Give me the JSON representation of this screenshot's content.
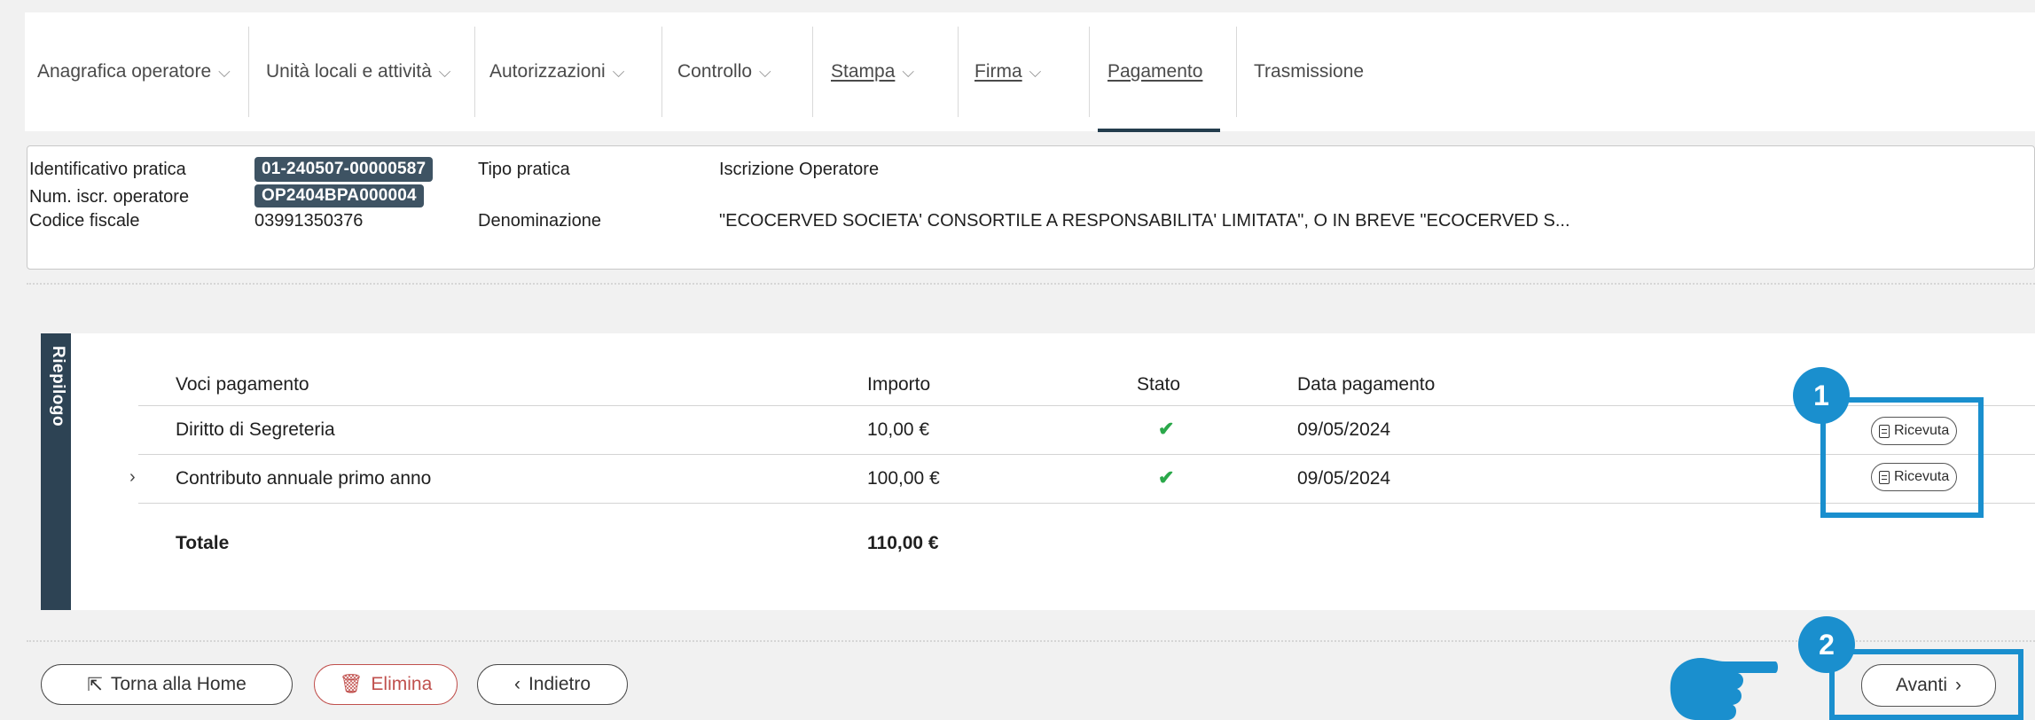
{
  "tabs": [
    {
      "label": "Anagrafica operatore",
      "chevron": true,
      "link": false
    },
    {
      "label": "Unità locali e attività",
      "chevron": true,
      "link": false
    },
    {
      "label": "Autorizzazioni",
      "chevron": true,
      "link": false
    },
    {
      "label": "Controllo",
      "chevron": true,
      "link": false
    },
    {
      "label": "Stampa",
      "chevron": true,
      "link": true
    },
    {
      "label": "Firma",
      "chevron": true,
      "link": true
    },
    {
      "label": "Pagamento",
      "chevron": false,
      "link": true,
      "active": true
    },
    {
      "label": "Trasmissione",
      "chevron": false,
      "link": false
    }
  ],
  "info": {
    "id_label": "Identificativo pratica",
    "id_value": "01-240507-00000587",
    "num_label": "Num. iscr. operatore",
    "num_value": "OP2404BPA000004",
    "cf_label": "Codice fiscale",
    "cf_value": "03991350376",
    "tipo_label": "Tipo pratica",
    "tipo_value": "Iscrizione Operatore",
    "denom_label": "Denominazione",
    "denom_value": "\"ECOCERVED SOCIETA' CONSORTILE A RESPONSABILITA' LIMITATA\", O IN BREVE \"ECOCERVED S..."
  },
  "summary": {
    "side_label": "Riepilogo",
    "headers": {
      "voci": "Voci pagamento",
      "importo": "Importo",
      "stato": "Stato",
      "data": "Data pagamento"
    },
    "rows": [
      {
        "voce": "Diritto di Segreteria",
        "importo": "10,00 €",
        "data": "09/05/2024",
        "receipt": "Ricevuta",
        "expandable": false
      },
      {
        "voce": "Contributo annuale primo anno",
        "importo": "100,00 €",
        "data": "09/05/2024",
        "receipt": "Ricevuta",
        "expandable": true
      }
    ],
    "total_label": "Totale",
    "total_value": "110,00 €"
  },
  "buttons": {
    "home": "Torna alla Home",
    "elimina": "Elimina",
    "indietro": "Indietro",
    "avanti": "Avanti"
  },
  "callouts": {
    "one": "1",
    "two": "2"
  },
  "colors": {
    "accent": "#1a8fce",
    "chip": "#3e5363",
    "success": "#2aa84a",
    "danger": "#c0504d",
    "side_tab": "#2d4354"
  }
}
